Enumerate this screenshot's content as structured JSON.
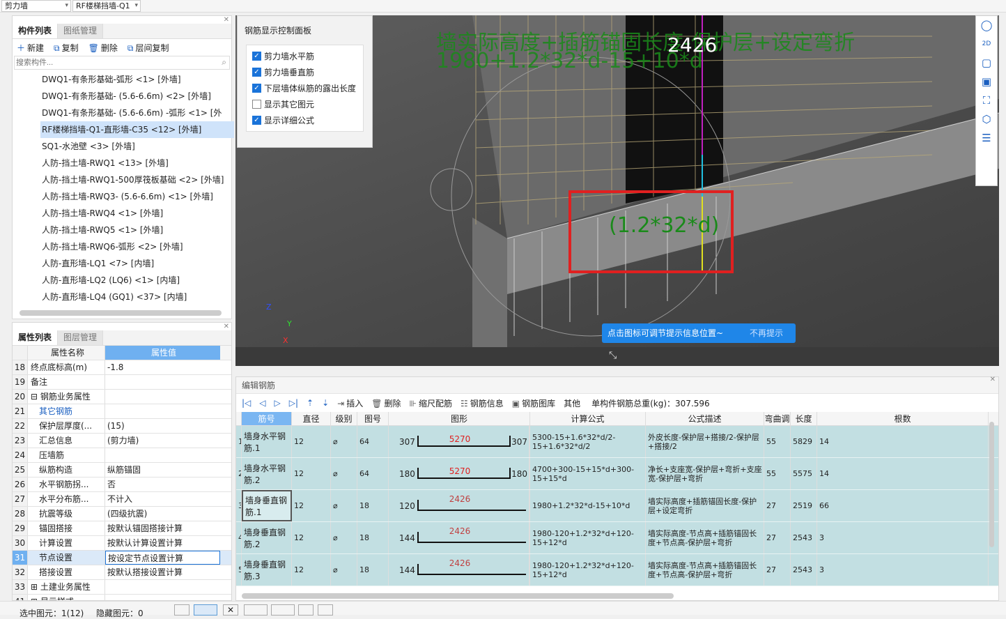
{
  "topbar": {
    "dropdown1": "剪力墙",
    "dropdown2": "RF楼梯挡墙-Q1"
  },
  "component_panel": {
    "tabs": [
      "构件列表",
      "图纸管理"
    ],
    "toolbar": [
      "新建",
      "复制",
      "删除",
      "层间复制"
    ],
    "search_placeholder": "搜索构件...",
    "items": [
      "DWQ1-有条形基础-弧形 <1> [外墙]",
      "DWQ1-有条形基础- (5.6-6.6m)  <2> [外墙]",
      "DWQ1-有条形基础- (5.6-6.6m) -弧形 <1> [外",
      "RF楼梯挡墙-Q1-直形墙-C35 <12> [外墙]",
      "SQ1-水池壁 <3> [外墙]",
      "人防-挡土墙-RWQ1 <13> [外墙]",
      "人防-挡土墙-RWQ1-500厚筏板基础 <2> [外墙]",
      "人防-挡土墙-RWQ3- (5.6-6.6m)  <1> [外墙]",
      "人防-挡土墙-RWQ4 <1> [外墙]",
      "人防-挡土墙-RWQ5 <1> [外墙]",
      "人防-挡土墙-RWQ6-弧形 <2> [外墙]",
      "人防-直形墙-LQ1 <7> [内墙]",
      "人防-直形墙-LQ2 (LQ6)  <1> [内墙]",
      "人防-直形墙-LQ4 (GQ1)  <37> [内墙]"
    ],
    "selected_index": 3
  },
  "property_panel": {
    "tabs": [
      "属性列表",
      "图层管理"
    ],
    "headers": [
      "属性名称",
      "属性值"
    ],
    "rows": [
      [
        "18",
        "终点底标高(m)",
        "-1.8"
      ],
      [
        "19",
        "备注",
        ""
      ],
      [
        "20",
        "⊟ 钢筋业务属性",
        ""
      ],
      [
        "21",
        "其它钢筋",
        ""
      ],
      [
        "22",
        "保护层厚度(...",
        "(15)"
      ],
      [
        "23",
        "汇总信息",
        "(剪力墙)"
      ],
      [
        "24",
        "压墙筋",
        ""
      ],
      [
        "25",
        "纵筋构造",
        "纵筋锚固"
      ],
      [
        "26",
        "水平钢筋拐...",
        "否"
      ],
      [
        "27",
        "水平分布筋...",
        "不计入"
      ],
      [
        "28",
        "抗震等级",
        "(四级抗震)"
      ],
      [
        "29",
        "锚固搭接",
        "按默认锚固搭接计算"
      ],
      [
        "30",
        "计算设置",
        "按默认计算设置计算"
      ],
      [
        "31",
        "节点设置",
        "按设定节点设置计算"
      ],
      [
        "32",
        "搭接设置",
        "按默认搭接设置计算"
      ],
      [
        "33",
        "⊞ 土建业务属性",
        ""
      ],
      [
        "41",
        "⊞ 显示样式",
        ""
      ]
    ]
  },
  "control_panel": {
    "title": "钢筋显示控制面板",
    "options": [
      {
        "label": "剪力墙水平筋",
        "checked": true
      },
      {
        "label": "剪力墙垂直筋",
        "checked": true
      },
      {
        "label": "下层墙体纵筋的露出长度",
        "checked": true
      },
      {
        "label": "显示其它图元",
        "checked": false
      },
      {
        "label": "显示详细公式",
        "checked": true
      }
    ]
  },
  "view": {
    "formula_desc": "墙实际高度+插筋锚固长度-保护层+设定弯折",
    "formula": "1980+1.2*32*d-15+10*d",
    "dimension": "2426",
    "highlight_label": "(1.2*32*d)",
    "tip": "点击图标可调节提示信息位置~",
    "tip_dismiss": "不再提示",
    "axes": [
      "Z",
      "Y",
      "X"
    ]
  },
  "edit_panel": {
    "title": "编辑钢筋",
    "toolbar": [
      "插入",
      "删除",
      "缩尺配筋",
      "钢筋信息",
      "钢筋图库",
      "其他"
    ],
    "total_label": "单构件钢筋总重(kg)：",
    "total": "307.596",
    "headers": [
      "",
      "筋号",
      "直径(mm)",
      "级别",
      "图号",
      "图形",
      "计算公式",
      "公式描述",
      "弯曲调整",
      "长度",
      "根数"
    ],
    "rows": [
      {
        "idx": "1",
        "name": "墙身水平钢筋.1",
        "dia": "12",
        "grade": "⌀",
        "fig": "64",
        "left": "307",
        "mid": "5270",
        "right": "307",
        "formula": "5300-15+1.6*32*d/2-15+1.6*32*d/2",
        "desc": "外皮长度-保护层+搭接/2-保护层+搭接/2",
        "bend": "55",
        "len": "5829",
        "count": "14"
      },
      {
        "idx": "2",
        "name": "墙身水平钢筋.2",
        "dia": "12",
        "grade": "⌀",
        "fig": "64",
        "left": "180",
        "mid": "5270",
        "right": "180",
        "formula": "4700+300-15+15*d+300-15+15*d",
        "desc": "净长+支座宽-保护层+弯折+支座宽-保护层+弯折",
        "bend": "55",
        "len": "5575",
        "count": "14"
      },
      {
        "idx": "3",
        "name": "墙身垂直钢筋.1",
        "dia": "12",
        "grade": "⌀",
        "fig": "18",
        "left": "120",
        "mid": "2426",
        "right": "",
        "formula": "1980+1.2*32*d-15+10*d",
        "desc": "墙实际高度+插筋锚固长度-保护层+设定弯折",
        "bend": "27",
        "len": "2519",
        "count": "66"
      },
      {
        "idx": "4",
        "name": "墙身垂直钢筋.2",
        "dia": "12",
        "grade": "⌀",
        "fig": "18",
        "left": "144",
        "mid": "2426",
        "right": "",
        "formula": "1980-120+1.2*32*d+120-15+12*d",
        "desc": "墙实际高度-节点高+插筋锚固长度+节点高-保护层+弯折",
        "bend": "27",
        "len": "2543",
        "count": "3"
      },
      {
        "idx": "5",
        "name": "墙身垂直钢筋.3",
        "dia": "12",
        "grade": "⌀",
        "fig": "18",
        "left": "144",
        "mid": "2426",
        "right": "",
        "formula": "1980-120+1.2*32*d+120-15+12*d",
        "desc": "墙实际高度-节点高+插筋锚固长度+节点高-保护层+弯折",
        "bend": "27",
        "len": "2543",
        "count": "3"
      }
    ]
  },
  "status": {
    "selected": "选中图元：1(12)",
    "hidden": "隐藏图元：0"
  },
  "colors": {
    "accent": "#1a73d9",
    "formula_green": "#1a8a1a",
    "highlight_red": "#e02020",
    "row_bg": "#c2dfe2"
  }
}
